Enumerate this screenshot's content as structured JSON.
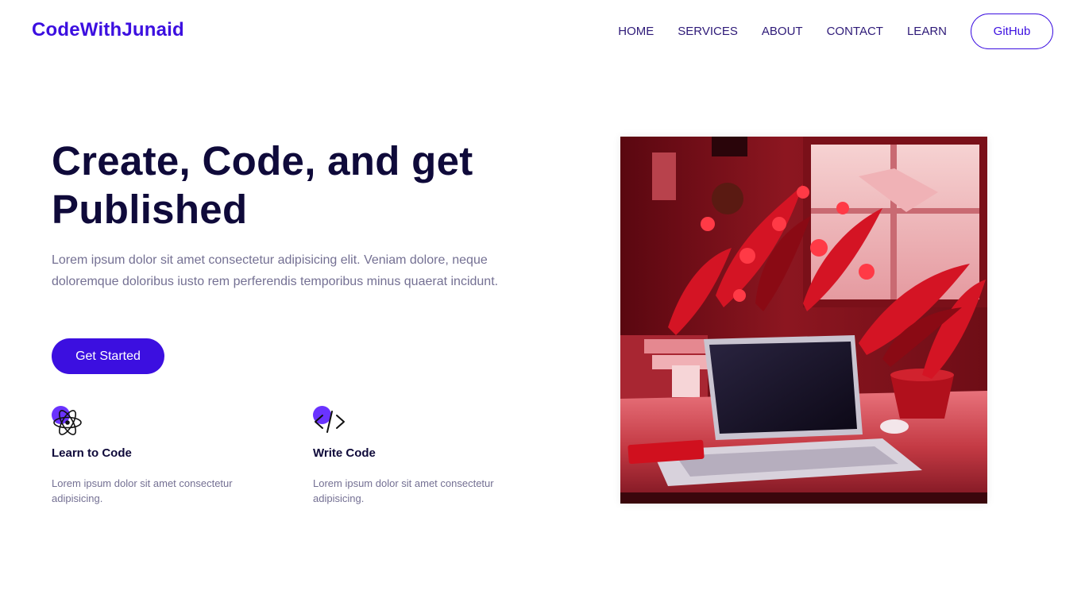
{
  "nav": {
    "brand": "CodeWithJunaid",
    "links": [
      "HOME",
      "SERVICES",
      "ABOUT",
      "CONTACT",
      "LEARN"
    ],
    "github_label": "GitHub"
  },
  "hero": {
    "title": "Create, Code, and get Published",
    "description": "Lorem ipsum dolor sit amet consectetur adipisicing elit. Veniam dolore, neque doloremque doloribus iusto rem perferendis temporibus minus quaerat incidunt.",
    "cta_label": "Get Started"
  },
  "features": [
    {
      "icon": "atom-icon",
      "title": "Learn to Code",
      "description": "Lorem ipsum dolor sit amet consectetur adipisicing."
    },
    {
      "icon": "code-icon",
      "title": "Write Code",
      "description": "Lorem ipsum dolor sit amet consectetur adipisicing."
    }
  ],
  "colors": {
    "accent": "#3c0fe0",
    "accent_dot": "#6a33ff",
    "heading": "#0f0a3a",
    "muted": "#747093"
  }
}
